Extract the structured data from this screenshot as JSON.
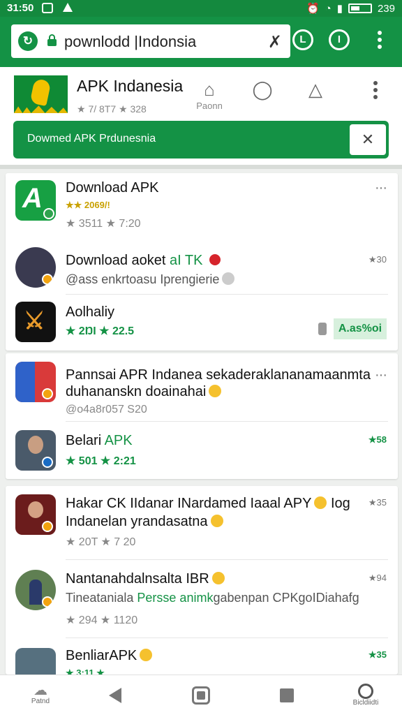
{
  "status_bar": {
    "time": "31:50",
    "battery": "239"
  },
  "browser": {
    "url_text": "pownlodd |Indonsia"
  },
  "site": {
    "title": "APK Indanesia",
    "rating": "★ 7/ 8Τ7 ★ 328",
    "actions": [
      {
        "label": "Paonn"
      }
    ],
    "banner_text": "Dowmed APK Prdunesnia"
  },
  "feed": [
    {
      "title": "Download APK",
      "rating_line": "★★ 2069/!",
      "meta": "★ 3511 ★ 7:20"
    },
    {
      "title": "Download aoket",
      "title_green": " aI TK",
      "subtitle": "@ass enkrtoasu Iprengierie",
      "side": "★30"
    },
    {
      "title": "Aolhaliy",
      "meta": "★ 2ŊI ★ 22.5",
      "install": "A.as%oi"
    },
    {
      "title": "Pannsai APR Indanea sekaderaklananamaanmta",
      "subtitle": "duhananskn doainahai",
      "meta": "@o4a8r057 S20"
    },
    {
      "title": "Belari",
      "title_green": " APK",
      "meta": "★ 501 ★ 2:21",
      "side": "★58"
    },
    {
      "title": "Hakar CK IIdanar INardamed Iaaal APY",
      "title_suffix": "Iog",
      "subtitle": "Indanelan yrandasatna",
      "meta": "★ 20Τ ★ 7 20",
      "side": "★35"
    },
    {
      "title": "Nantanahdalnsalta IBR",
      "subtitle": "Tineataniala",
      "subtitle_green": " Persse animk",
      "subtitle_tail": "gabenpan CPKgoIDiahafg",
      "meta": "★ 294 ★ 1120",
      "side": "★94"
    },
    {
      "title": "BenliarAPK",
      "meta": "★ 3:11 ★",
      "side": "★35"
    }
  ],
  "nav": {
    "first_label": "Patnd",
    "last_label": "Bicldiidti"
  },
  "colors": {
    "primary_green": "#149245",
    "status_green": "#14893e",
    "badge_orange": "#f2a30f"
  }
}
